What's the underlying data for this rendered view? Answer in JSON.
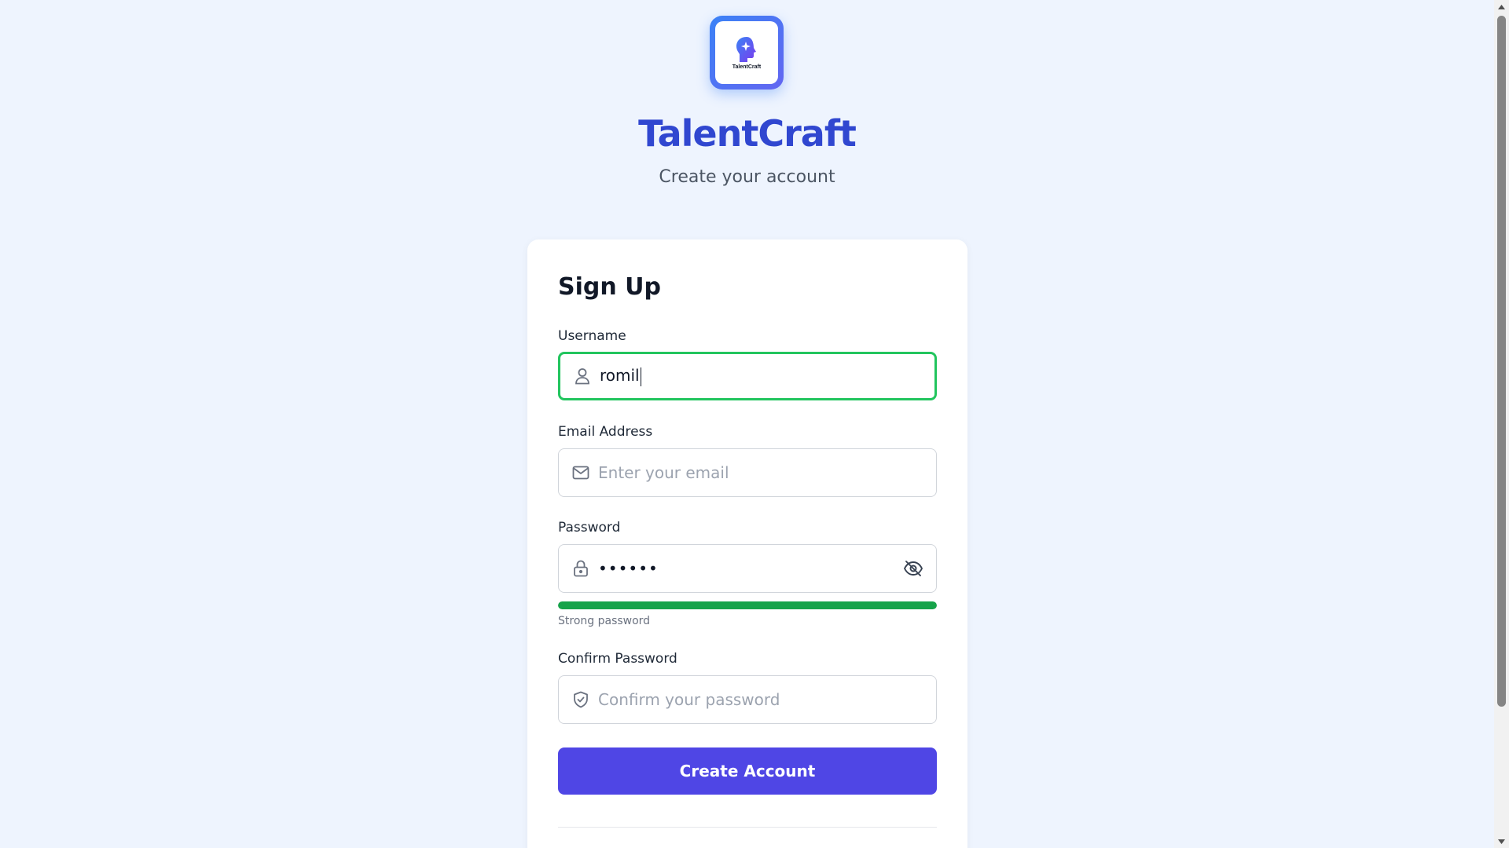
{
  "brand": {
    "logo_text": "TalentCraft",
    "title": "TalentCraft",
    "subtitle": "Create your account"
  },
  "form": {
    "title": "Sign Up",
    "username": {
      "label": "Username",
      "value": "romil",
      "icon": "user-icon"
    },
    "email": {
      "label": "Email Address",
      "placeholder": "Enter your email",
      "value": "",
      "icon": "mail-icon"
    },
    "password": {
      "label": "Password",
      "value": "••••••",
      "icon": "lock-icon",
      "toggle_icon": "eye-off-icon",
      "strength_text": "Strong password",
      "strength_fraction": 1.0
    },
    "confirm_password": {
      "label": "Confirm Password",
      "placeholder": "Confirm your password",
      "value": "",
      "icon": "shield-check-icon"
    },
    "submit_label": "Create Account"
  },
  "colors": {
    "background": "#eef4fe",
    "brand_title": "#3047d0",
    "primary_button": "#4f46e5",
    "active_border": "#22c55e",
    "strength_bar": "#16a34a"
  }
}
